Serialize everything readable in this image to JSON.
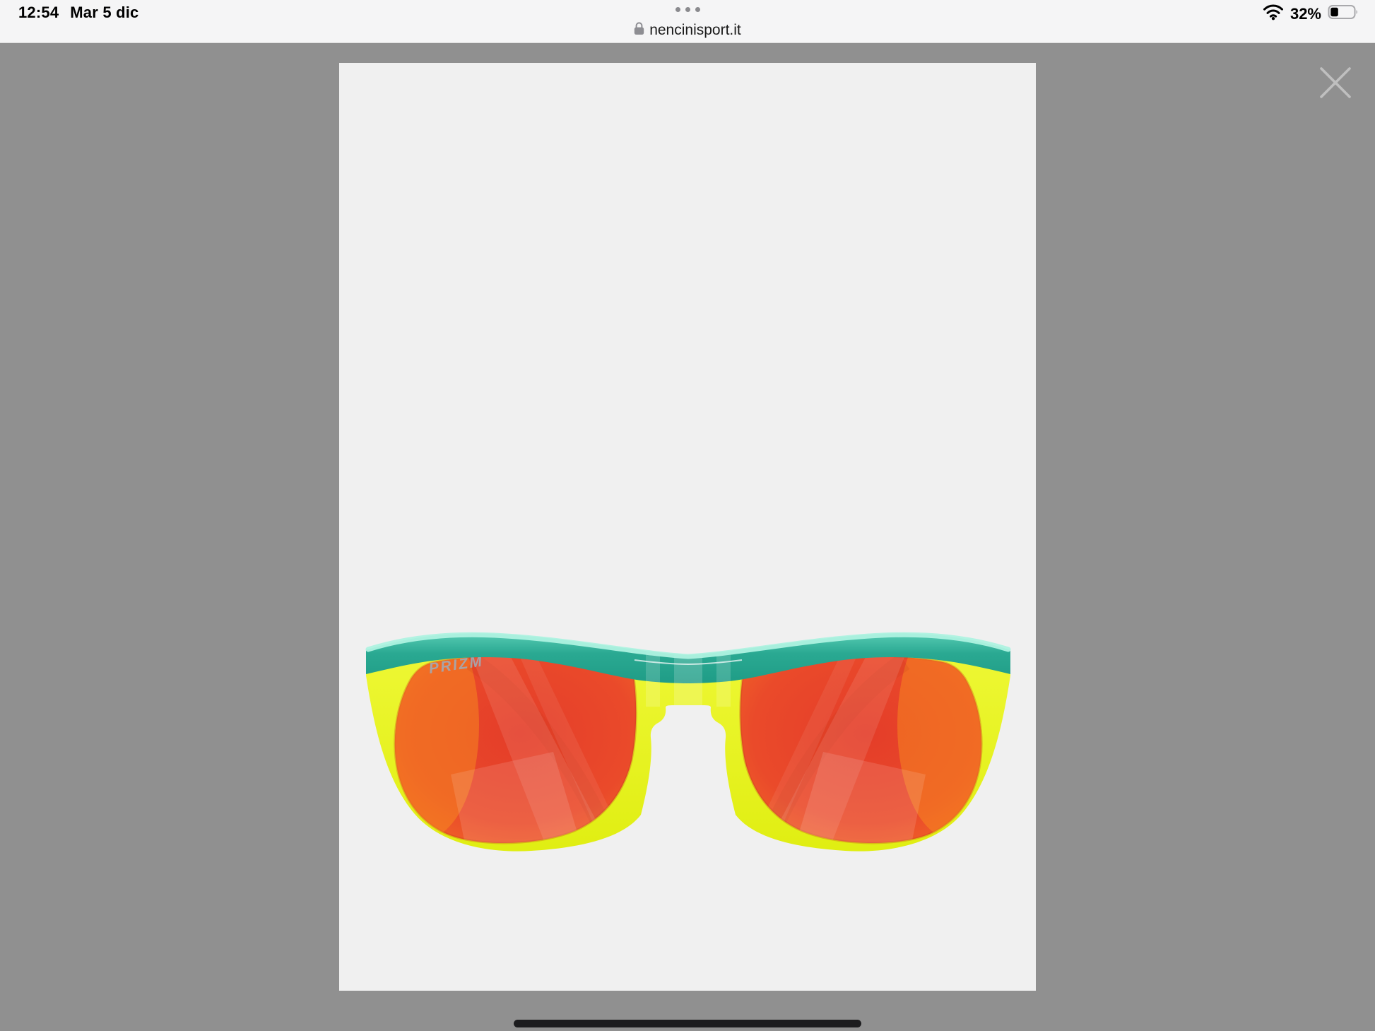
{
  "status_bar": {
    "time": "12:54",
    "date": "Mar 5 dic",
    "battery_percent": "32%"
  },
  "url_bar": {
    "domain": "nencinisport.it"
  },
  "icons": {
    "ellipsis": "ellipsis-icon",
    "lock": "lock-icon",
    "wifi": "wifi-icon",
    "battery": "battery-icon",
    "close": "close-icon"
  },
  "lightbox": {
    "product": {
      "lens_label": "PRIZM",
      "colors": {
        "brow_top_highlight": "#aef2e0",
        "brow_teal_light": "#56cab2",
        "brow_teal": "#2aa992",
        "brow_teal_deep": "#1f9c86",
        "frame_yellow_light": "#eff837",
        "frame_yellow": "#e0ee12",
        "lens_red": "#e43d29",
        "lens_red_mid": "#ea4a2a",
        "lens_orange": "#f06328",
        "lens_orange_edge": "#f88522",
        "prizm_text": "#a3aab4",
        "image_background": "#f0f0f0"
      }
    }
  },
  "overlay": {
    "color": "#909090"
  }
}
